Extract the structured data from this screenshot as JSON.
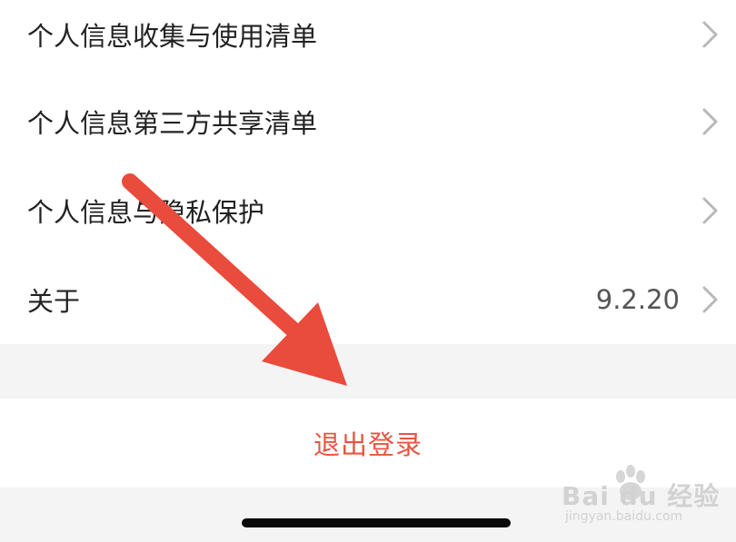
{
  "settings": {
    "items": [
      {
        "label": "个人信息收集与使用清单",
        "value": ""
      },
      {
        "label": "个人信息第三方共享清单",
        "value": ""
      },
      {
        "label": "个人信息与隐私保护",
        "value": ""
      },
      {
        "label": "关于",
        "value": "9.2.20"
      }
    ]
  },
  "logout": {
    "label": "退出登录",
    "color": "#e8543f"
  },
  "annotation": {
    "arrow_color": "#e94b3c"
  },
  "watermark": {
    "brand_text": "Bai du 经验",
    "url": "jingyan.baidu.com"
  },
  "icons": {
    "row_chevron": "chevron-right-icon",
    "watermark_paw": "baidu-paw-icon"
  }
}
